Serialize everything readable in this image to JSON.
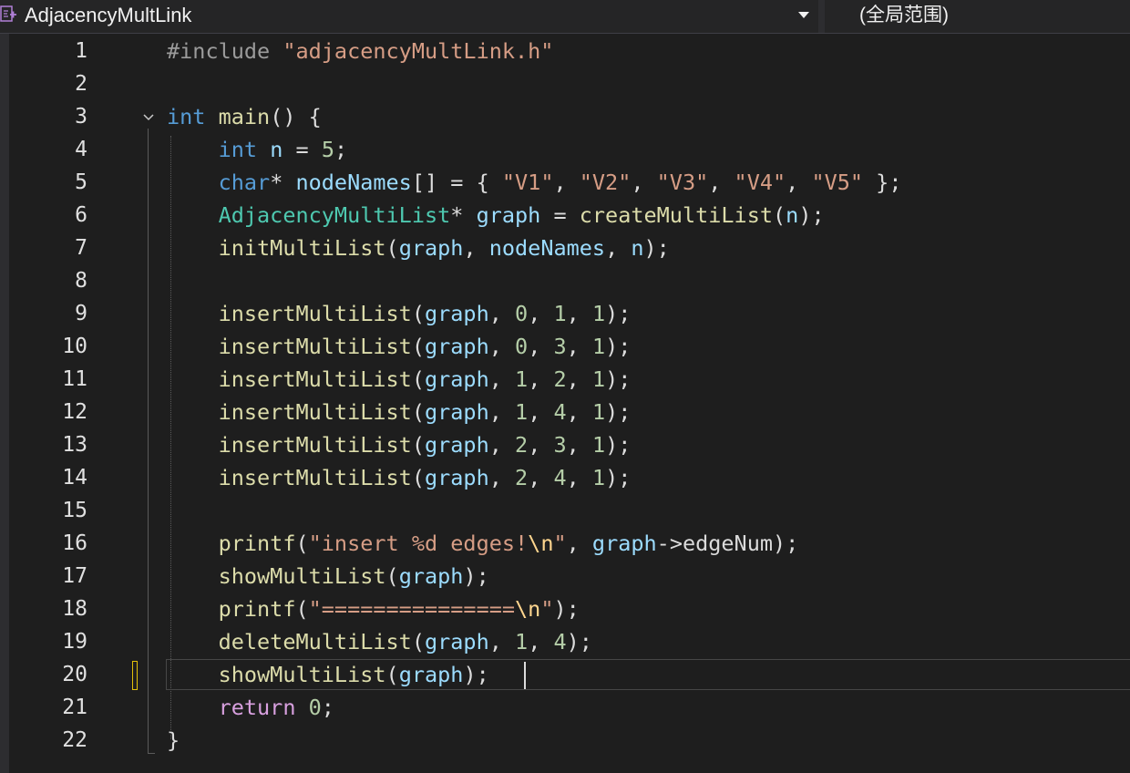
{
  "navbar": {
    "file_name": "AdjacencyMultLink",
    "scope_label": "(全局范围)"
  },
  "editor": {
    "line_numbers": [
      "1",
      "2",
      "3",
      "4",
      "5",
      "6",
      "7",
      "8",
      "9",
      "10",
      "11",
      "12",
      "13",
      "14",
      "15",
      "16",
      "17",
      "18",
      "19",
      "20",
      "21",
      "22"
    ],
    "current_line": 20,
    "lines": [
      [
        [
          "t-pre",
          "#include "
        ],
        [
          "t-str",
          "\"adjacencyMultLink.h\""
        ]
      ],
      [],
      [
        [
          "t-kw",
          "int"
        ],
        [
          "t-pun",
          " "
        ],
        [
          "t-fn",
          "main"
        ],
        [
          "t-pun",
          "() {"
        ]
      ],
      [
        [
          "t-pun",
          "    "
        ],
        [
          "t-kw",
          "int"
        ],
        [
          "t-pun",
          " "
        ],
        [
          "t-var",
          "n"
        ],
        [
          "t-pun",
          " = "
        ],
        [
          "t-num",
          "5"
        ],
        [
          "t-pun",
          ";"
        ]
      ],
      [
        [
          "t-pun",
          "    "
        ],
        [
          "t-kw",
          "char"
        ],
        [
          "t-pun",
          "* "
        ],
        [
          "t-var",
          "nodeNames"
        ],
        [
          "t-pun",
          "[] = { "
        ],
        [
          "t-str",
          "\"V1\""
        ],
        [
          "t-pun",
          ", "
        ],
        [
          "t-str",
          "\"V2\""
        ],
        [
          "t-pun",
          ", "
        ],
        [
          "t-str",
          "\"V3\""
        ],
        [
          "t-pun",
          ", "
        ],
        [
          "t-str",
          "\"V4\""
        ],
        [
          "t-pun",
          ", "
        ],
        [
          "t-str",
          "\"V5\""
        ],
        [
          "t-pun",
          " };"
        ]
      ],
      [
        [
          "t-pun",
          "    "
        ],
        [
          "t-type",
          "AdjacencyMultiList"
        ],
        [
          "t-pun",
          "* "
        ],
        [
          "t-var",
          "graph"
        ],
        [
          "t-pun",
          " = "
        ],
        [
          "t-fn",
          "createMultiList"
        ],
        [
          "t-pun",
          "("
        ],
        [
          "t-var",
          "n"
        ],
        [
          "t-pun",
          ");"
        ]
      ],
      [
        [
          "t-pun",
          "    "
        ],
        [
          "t-fn",
          "initMultiList"
        ],
        [
          "t-pun",
          "("
        ],
        [
          "t-var",
          "graph"
        ],
        [
          "t-pun",
          ", "
        ],
        [
          "t-var",
          "nodeNames"
        ],
        [
          "t-pun",
          ", "
        ],
        [
          "t-var",
          "n"
        ],
        [
          "t-pun",
          ");"
        ]
      ],
      [],
      [
        [
          "t-pun",
          "    "
        ],
        [
          "t-fn",
          "insertMultiList"
        ],
        [
          "t-pun",
          "("
        ],
        [
          "t-var",
          "graph"
        ],
        [
          "t-pun",
          ", "
        ],
        [
          "t-num",
          "0"
        ],
        [
          "t-pun",
          ", "
        ],
        [
          "t-num",
          "1"
        ],
        [
          "t-pun",
          ", "
        ],
        [
          "t-num",
          "1"
        ],
        [
          "t-pun",
          ");"
        ]
      ],
      [
        [
          "t-pun",
          "    "
        ],
        [
          "t-fn",
          "insertMultiList"
        ],
        [
          "t-pun",
          "("
        ],
        [
          "t-var",
          "graph"
        ],
        [
          "t-pun",
          ", "
        ],
        [
          "t-num",
          "0"
        ],
        [
          "t-pun",
          ", "
        ],
        [
          "t-num",
          "3"
        ],
        [
          "t-pun",
          ", "
        ],
        [
          "t-num",
          "1"
        ],
        [
          "t-pun",
          ");"
        ]
      ],
      [
        [
          "t-pun",
          "    "
        ],
        [
          "t-fn",
          "insertMultiList"
        ],
        [
          "t-pun",
          "("
        ],
        [
          "t-var",
          "graph"
        ],
        [
          "t-pun",
          ", "
        ],
        [
          "t-num",
          "1"
        ],
        [
          "t-pun",
          ", "
        ],
        [
          "t-num",
          "2"
        ],
        [
          "t-pun",
          ", "
        ],
        [
          "t-num",
          "1"
        ],
        [
          "t-pun",
          ");"
        ]
      ],
      [
        [
          "t-pun",
          "    "
        ],
        [
          "t-fn",
          "insertMultiList"
        ],
        [
          "t-pun",
          "("
        ],
        [
          "t-var",
          "graph"
        ],
        [
          "t-pun",
          ", "
        ],
        [
          "t-num",
          "1"
        ],
        [
          "t-pun",
          ", "
        ],
        [
          "t-num",
          "4"
        ],
        [
          "t-pun",
          ", "
        ],
        [
          "t-num",
          "1"
        ],
        [
          "t-pun",
          ");"
        ]
      ],
      [
        [
          "t-pun",
          "    "
        ],
        [
          "t-fn",
          "insertMultiList"
        ],
        [
          "t-pun",
          "("
        ],
        [
          "t-var",
          "graph"
        ],
        [
          "t-pun",
          ", "
        ],
        [
          "t-num",
          "2"
        ],
        [
          "t-pun",
          ", "
        ],
        [
          "t-num",
          "3"
        ],
        [
          "t-pun",
          ", "
        ],
        [
          "t-num",
          "1"
        ],
        [
          "t-pun",
          ");"
        ]
      ],
      [
        [
          "t-pun",
          "    "
        ],
        [
          "t-fn",
          "insertMultiList"
        ],
        [
          "t-pun",
          "("
        ],
        [
          "t-var",
          "graph"
        ],
        [
          "t-pun",
          ", "
        ],
        [
          "t-num",
          "2"
        ],
        [
          "t-pun",
          ", "
        ],
        [
          "t-num",
          "4"
        ],
        [
          "t-pun",
          ", "
        ],
        [
          "t-num",
          "1"
        ],
        [
          "t-pun",
          ");"
        ]
      ],
      [],
      [
        [
          "t-pun",
          "    "
        ],
        [
          "t-fn",
          "printf"
        ],
        [
          "t-pun",
          "("
        ],
        [
          "t-str",
          "\"insert %d edges!"
        ],
        [
          "t-esc",
          "\\n"
        ],
        [
          "t-str",
          "\""
        ],
        [
          "t-pun",
          ", "
        ],
        [
          "t-var",
          "graph"
        ],
        [
          "t-pun",
          "->"
        ],
        [
          "t-mem",
          "edgeNum"
        ],
        [
          "t-pun",
          ");"
        ]
      ],
      [
        [
          "t-pun",
          "    "
        ],
        [
          "t-fn",
          "showMultiList"
        ],
        [
          "t-pun",
          "("
        ],
        [
          "t-var",
          "graph"
        ],
        [
          "t-pun",
          ");"
        ]
      ],
      [
        [
          "t-pun",
          "    "
        ],
        [
          "t-fn",
          "printf"
        ],
        [
          "t-pun",
          "("
        ],
        [
          "t-str",
          "\"==============="
        ],
        [
          "t-esc",
          "\\n"
        ],
        [
          "t-str",
          "\""
        ],
        [
          "t-pun",
          ");"
        ]
      ],
      [
        [
          "t-pun",
          "    "
        ],
        [
          "t-fn",
          "deleteMultiList"
        ],
        [
          "t-pun",
          "("
        ],
        [
          "t-var",
          "graph"
        ],
        [
          "t-pun",
          ", "
        ],
        [
          "t-num",
          "1"
        ],
        [
          "t-pun",
          ", "
        ],
        [
          "t-num",
          "4"
        ],
        [
          "t-pun",
          ");"
        ]
      ],
      [
        [
          "t-pun",
          "    "
        ],
        [
          "t-fn",
          "showMultiList"
        ],
        [
          "t-pun",
          "("
        ],
        [
          "t-var",
          "graph"
        ],
        [
          "t-pun",
          ");"
        ]
      ],
      [
        [
          "t-pun",
          "    "
        ],
        [
          "t-ctl",
          "return"
        ],
        [
          "t-pun",
          " "
        ],
        [
          "t-num",
          "0"
        ],
        [
          "t-pun",
          ";"
        ]
      ],
      [
        [
          "t-pun",
          "}"
        ]
      ]
    ]
  }
}
